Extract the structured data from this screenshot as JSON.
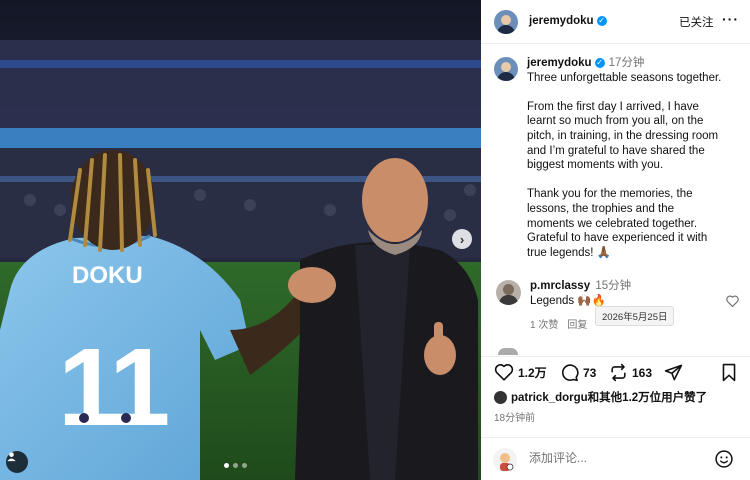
{
  "photo": {
    "jersey_name": "DOKU",
    "jersey_number": "11",
    "carousel_dots": 3,
    "active_dot": 0
  },
  "post": {
    "author": "jeremydoku",
    "verified": true,
    "follow_label": "已关注",
    "more_label": "···",
    "caption_time": "17分钟",
    "caption_paragraphs": [
      [
        "Three unforgettable seasons together."
      ],
      [
        "From the first day I arrived, I have",
        "learnt so much from you all, on the",
        "pitch, in training, in the dressing room",
        "and I’m grateful to have shared the",
        "biggest moments with you."
      ],
      [
        "Thank you for the memories, the",
        "lessons, the trophies and the",
        "moments we celebrated together.",
        "Grateful to have experienced it with",
        "true legends! 🙏🏾"
      ]
    ]
  },
  "comment": {
    "author": "p.mrclassy",
    "time": "15分钟",
    "text": "Legends 🙌🏾🔥",
    "likes": "1 次赞",
    "reply": "回复",
    "tooltip": "2026年5月25日"
  },
  "actions": {
    "likes": "1.2万",
    "comments": "73",
    "reposts": "163"
  },
  "liked_by": "patrick_dorgu和其他1.2万位用户赞了",
  "posted_ago": "18分钟前",
  "add_comment": {
    "placeholder": "添加评论..."
  },
  "colors": {
    "verified": "#0095f6",
    "jersey": "#6fb3e0",
    "meta_text": "#737373"
  }
}
